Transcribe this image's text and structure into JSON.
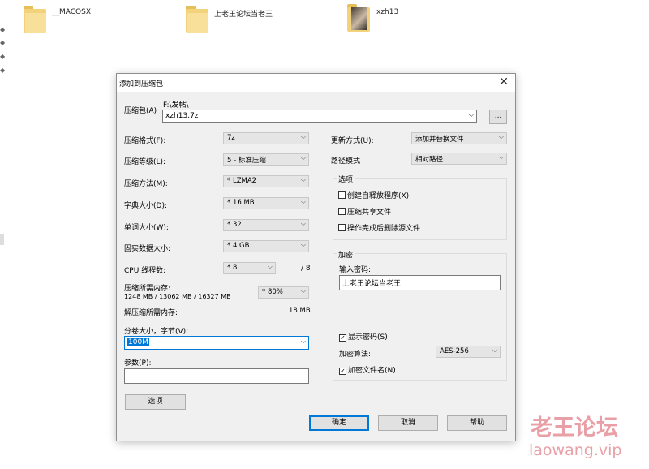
{
  "desktop": {
    "folders": [
      {
        "name": "__MACOSX"
      },
      {
        "name": "上老王论坛当老王"
      },
      {
        "name": "xzh13"
      }
    ]
  },
  "dialog": {
    "title": "添加到压缩包",
    "close_icon": "close-icon",
    "archive": {
      "label": "压缩包(A)",
      "path": "F:\\发帖\\",
      "value": "xzh13.7z",
      "browse_label": "..."
    },
    "left": {
      "format": {
        "label": "压缩格式(F):",
        "value": "7z"
      },
      "level": {
        "label": "压缩等级(L):",
        "value": "5 - 标准压缩"
      },
      "method": {
        "label": "压缩方法(M):",
        "value": "* LZMA2"
      },
      "dict": {
        "label": "字典大小(D):",
        "value": "* 16 MB"
      },
      "word": {
        "label": "单词大小(W):",
        "value": "* 32"
      },
      "solid": {
        "label": "固实数据大小:",
        "value": "* 4 GB"
      },
      "threads": {
        "label": "CPU 线程数:",
        "value": "* 8",
        "max": "/ 8"
      },
      "mem_comp": {
        "label": "压缩所需内存:",
        "detail": "1248 MB / 13062 MB / 16327 MB",
        "value": "* 80%"
      },
      "mem_decomp": {
        "label": "解压缩所需内存:",
        "value": "18 MB"
      },
      "volume": {
        "label": "分卷大小，字节(V):",
        "value": "100M"
      },
      "params": {
        "label": "参数(P):",
        "value": ""
      },
      "options_button": "选项"
    },
    "right": {
      "update": {
        "label": "更新方式(U):",
        "value": "添加并替换文件"
      },
      "pathmode": {
        "label": "路径模式",
        "value": "相对路径"
      },
      "options_group": {
        "title": "选项",
        "items": [
          {
            "label": "创建自释放程序(X)",
            "checked": false
          },
          {
            "label": "压缩共享文件",
            "checked": false
          },
          {
            "label": "操作完成后删除源文件",
            "checked": false
          }
        ]
      },
      "encrypt_group": {
        "title": "加密",
        "password_label": "输入密码:",
        "password_value": "上老王论坛当老王",
        "show_password": {
          "label": "显示密码(S)",
          "checked": true
        },
        "method_label": "加密算法:",
        "method_value": "AES-256",
        "encrypt_names": {
          "label": "加密文件名(N)",
          "checked": true
        }
      }
    },
    "buttons": {
      "ok": "确定",
      "cancel": "取消",
      "help": "帮助"
    }
  },
  "watermark": {
    "line1": "老王论坛",
    "line2": "laowang.vip"
  },
  "colors": {
    "accent": "#0078d7",
    "folder": "#f2d27a",
    "watermark": "#e8a0a6"
  }
}
